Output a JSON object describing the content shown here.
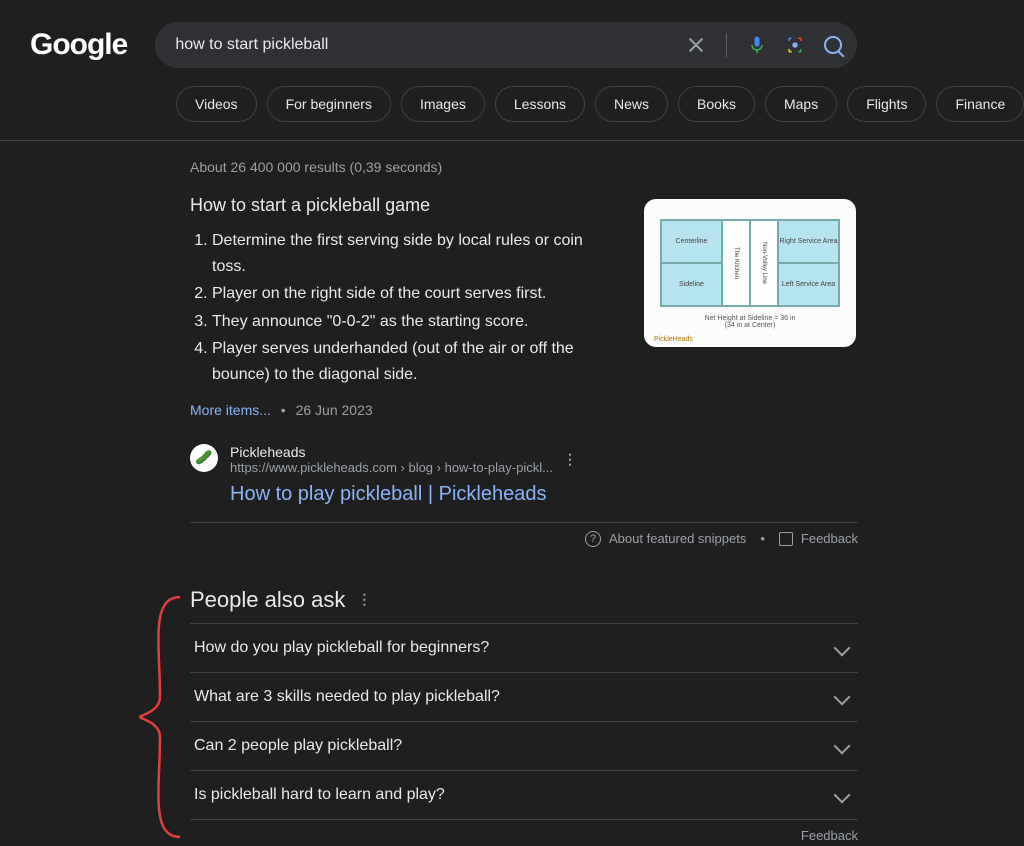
{
  "logo": "Google",
  "search": {
    "value": "how to start pickleball",
    "placeholder": ""
  },
  "chips": [
    "Videos",
    "For beginners",
    "Images",
    "Lessons",
    "News",
    "Books",
    "Maps",
    "Flights",
    "Finance"
  ],
  "stats": "About 26 400 000 results (0,39 seconds)",
  "snippet": {
    "title": "How to start a pickleball game",
    "steps": [
      "Determine the first serving side by local rules or coin toss.",
      "Player on the right side of the court serves first.",
      "They announce \"0-0-2\" as the starting score.",
      "Player serves underhanded (out of the air or off the bounce) to the diagonal side."
    ],
    "more": "More items...",
    "date": "26 Jun 2023",
    "image_labels": {
      "centerline": "Centerline",
      "sideline": "Sideline",
      "kitchen": "The Kitchen",
      "nonvolley": "Non-Volley Line",
      "rservice": "Right Service Area",
      "lservice": "Left Service Area",
      "netline": "Net Height at Sideline = 36 in",
      "netline2": "(34 in at Center)",
      "brand": "PickleHeads"
    }
  },
  "source": {
    "name": "Pickleheads",
    "url": "https://www.pickleheads.com › blog › how-to-play-pickl...",
    "title": "How to play pickleball | Pickleheads"
  },
  "snippet_footer": {
    "about": "About featured snippets",
    "feedback": "Feedback"
  },
  "paa": {
    "title": "People also ask",
    "items": [
      "How do you play pickleball for beginners?",
      "What are 3 skills needed to play pickleball?",
      "Can 2 people play pickleball?",
      "Is pickleball hard to learn and play?"
    ],
    "feedback": "Feedback"
  }
}
